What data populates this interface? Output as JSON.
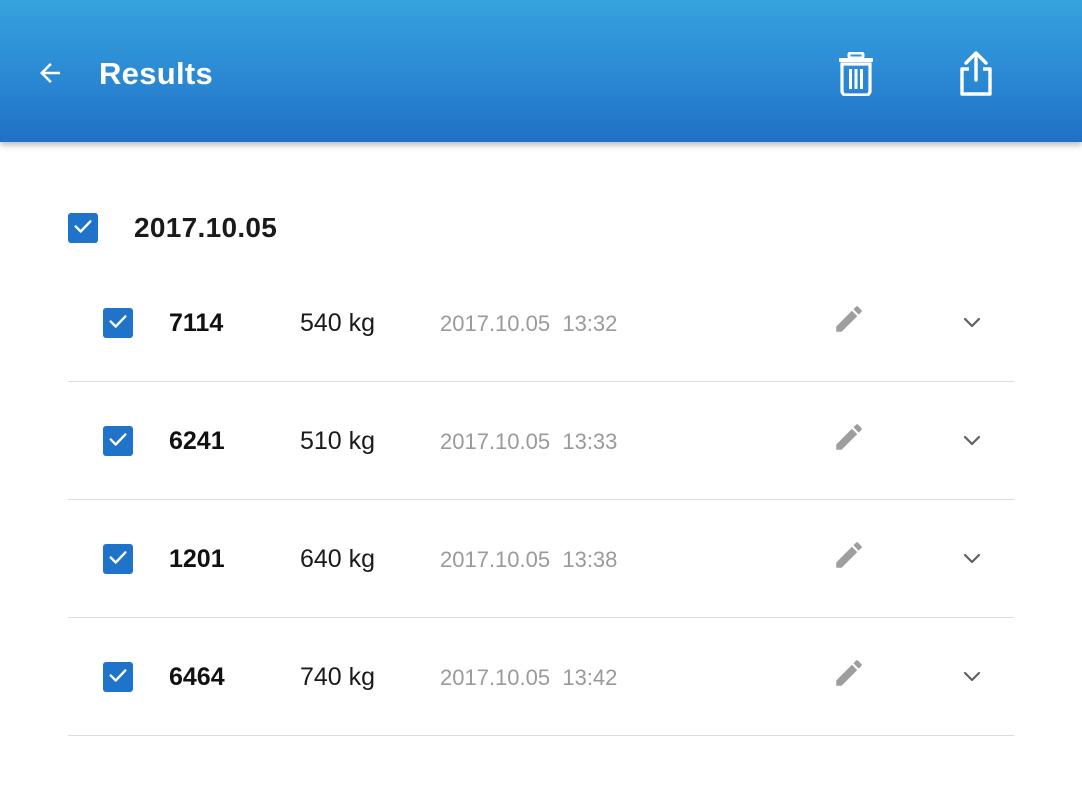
{
  "appbar": {
    "title": "Results",
    "back_icon": "arrow-back-icon",
    "delete_icon": "trash-icon",
    "share_icon": "share-icon",
    "background_color": "#2a86d2"
  },
  "group": {
    "date": "2017.10.05",
    "checked": true
  },
  "accent_color": "#1f73c8",
  "results": [
    {
      "id": "7114",
      "weight": "540 kg",
      "date": "2017.10.05",
      "time": "13:32",
      "checked": true
    },
    {
      "id": "6241",
      "weight": "510 kg",
      "date": "2017.10.05",
      "time": "13:33",
      "checked": true
    },
    {
      "id": "1201",
      "weight": "640 kg",
      "date": "2017.10.05",
      "time": "13:38",
      "checked": true
    },
    {
      "id": "6464",
      "weight": "740 kg",
      "date": "2017.10.05",
      "time": "13:42",
      "checked": true
    }
  ],
  "row_icons": {
    "edit": "pencil-icon",
    "expand": "chevron-down-icon"
  }
}
